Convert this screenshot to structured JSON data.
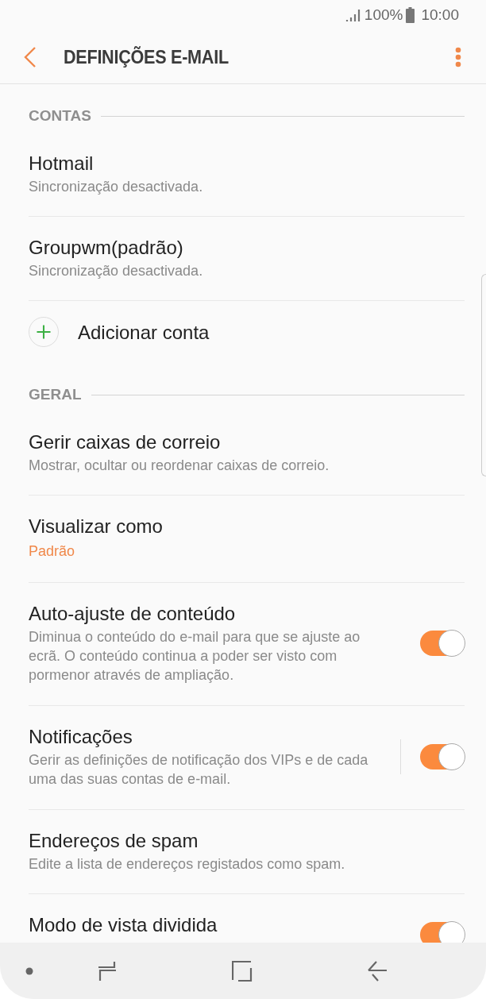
{
  "status_bar": {
    "battery": "100%",
    "time": "10:00"
  },
  "header": {
    "title": "DEFINIÇÕES E-MAIL"
  },
  "sections": [
    {
      "title": "CONTAS",
      "items": [
        {
          "kind": "text",
          "title": "Hotmail",
          "subtitle": "Sincronização desactivada."
        },
        {
          "kind": "text",
          "title": "Groupwm(padrão)",
          "subtitle": "Sincronização desactivada."
        },
        {
          "kind": "add",
          "title": "Adicionar conta"
        }
      ]
    },
    {
      "title": "GERAL",
      "items": [
        {
          "kind": "text",
          "title": "Gerir caixas de correio",
          "subtitle": "Mostrar, ocultar ou reordenar caixas de correio."
        },
        {
          "kind": "value",
          "title": "Visualizar como",
          "value": "Padrão"
        },
        {
          "kind": "toggle",
          "title": "Auto-ajuste de conteúdo",
          "subtitle": "Diminua o conteúdo do e-mail para que se ajuste ao ecrã. O conteúdo continua a poder ser visto com pormenor através de ampliação.",
          "on": true,
          "divided": false
        },
        {
          "kind": "toggle",
          "title": "Notificações",
          "subtitle": "Gerir as definições de notificação dos VIPs e de cada uma das suas contas de e-mail.",
          "on": true,
          "divided": true
        },
        {
          "kind": "text",
          "title": "Endereços de spam",
          "subtitle": "Edite a lista de endereços registados como spam."
        },
        {
          "kind": "toggle",
          "title": "Modo de vista dividida",
          "on": true,
          "divided": false
        }
      ]
    }
  ]
}
